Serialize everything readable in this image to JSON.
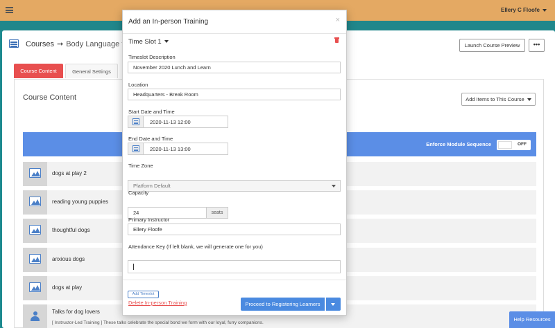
{
  "topbar": {
    "user_name": "Ellery C Floofe"
  },
  "breadcrumb": {
    "root": "Courses",
    "arrow": "➞",
    "current": "Body Language fo"
  },
  "header_buttons": {
    "launch_preview": "Launch Course Preview",
    "more": "•••"
  },
  "tabs": [
    {
      "label": "Course Content"
    },
    {
      "label": "General Settings"
    }
  ],
  "content": {
    "title": "Course Content",
    "add_items_label": "Add Items to This Course",
    "enforce_label": "Enforce Module Sequence",
    "enforce_toggle": "OFF",
    "modules": [
      {
        "title": "dogs at play 2"
      },
      {
        "title": "reading young puppies"
      },
      {
        "title": "thoughtful dogs"
      },
      {
        "title": "anxious dogs"
      },
      {
        "title": "dogs at play"
      },
      {
        "title": "Talks for dog lovers",
        "subtitle": "[ Instructor-Led Training ] These talks celebrate the special bond we form with our loyal, furry companions."
      }
    ]
  },
  "help_resources": "Help Resources",
  "modal": {
    "title": "Add an In-person Training",
    "close": "×",
    "timeslot_heading": "Time Slot 1",
    "fields": {
      "description_label": "Timeslot Description",
      "description_value": "November 2020 Lunch and Learn",
      "location_label": "Location",
      "location_value": "Headquarters - Break Room",
      "start_label": "Start Date and Time",
      "start_value": "2020-11-13 12:00",
      "end_label": "End Date and Time",
      "end_value": "2020-11-13 13:00",
      "timezone_label": "Time Zone",
      "timezone_value": "Platform Default",
      "capacity_label": "Capacity",
      "capacity_value": "24",
      "capacity_addon": "seats",
      "instructor_label": "Primary Instructor",
      "instructor_value": "Ellery Floofe",
      "attendance_label": "Attendance Key (If left blank, we will generate one for you)"
    },
    "add_timeslot": "Add Timeslot",
    "delete_link": "Delete In-person Training",
    "proceed_button": "Proceed to Registering Learners"
  }
}
